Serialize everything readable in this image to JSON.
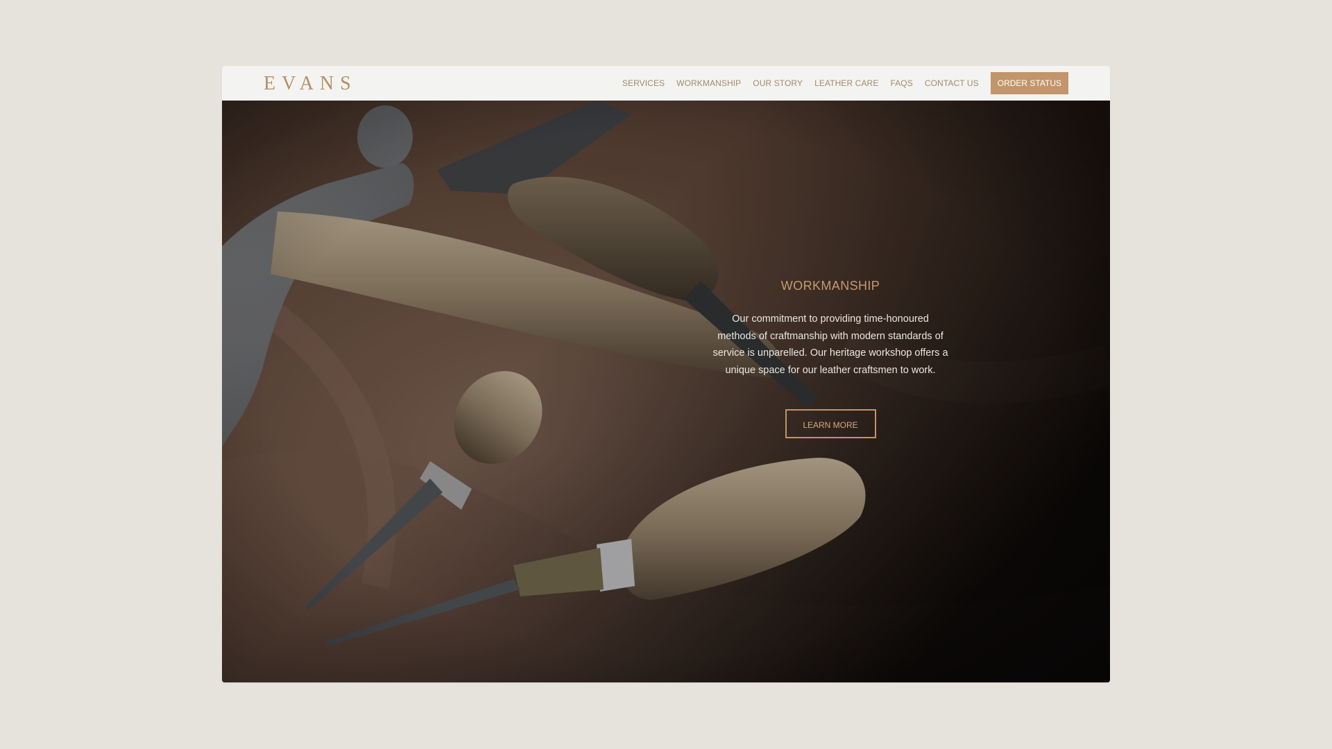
{
  "brand": {
    "logo_text": "EVANS",
    "accent_color": "#c2956a",
    "background_color": "#e6e3dc"
  },
  "nav": {
    "items": [
      "SERVICES",
      "WORKMANSHIP",
      "OUR STORY",
      "LEATHER CARE",
      "FAQS",
      "CONTACT US"
    ],
    "order_status_label": "ORDER STATUS"
  },
  "hero": {
    "image_subject": "leatherworking hand tools on brown leather",
    "heading": "WORKMANSHIP",
    "body": "Our commitment to providing time-honoured methods of craftmanship with modern standards of service is unparelled. Our heritage workshop offers a unique space for our leather craftsmen to work.",
    "cta_label": "LEARN MORE"
  }
}
